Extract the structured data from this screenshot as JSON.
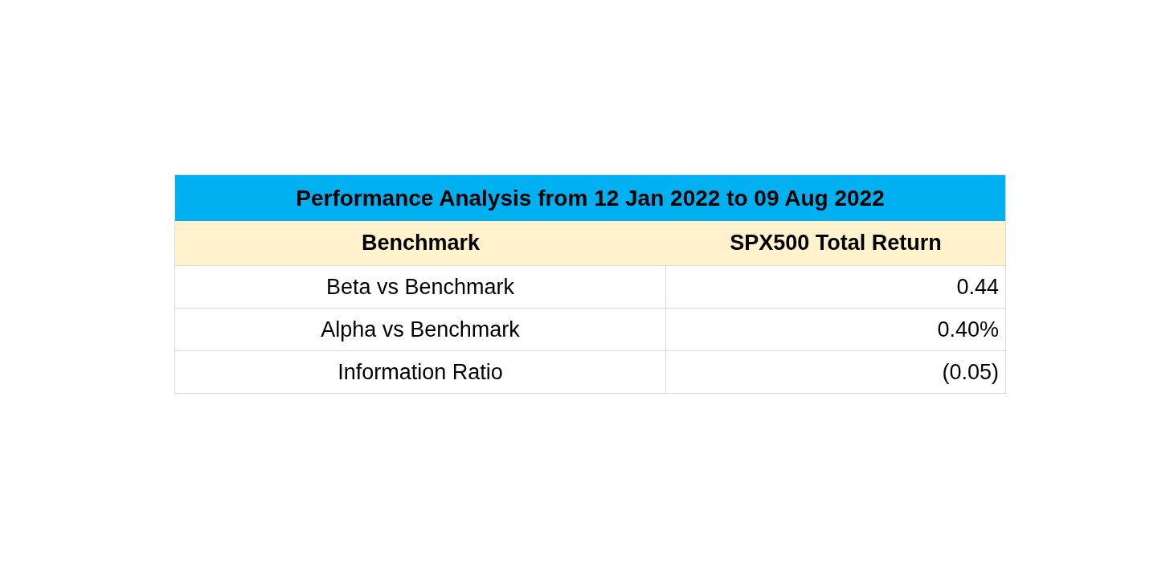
{
  "title": "Performance Analysis from 12 Jan 2022 to 09 Aug 2022",
  "header": [
    "Benchmark",
    "SPX500 Total Return"
  ],
  "rows": [
    {
      "label": "Beta vs Benchmark",
      "value": "0.44"
    },
    {
      "label": "Alpha vs Benchmark",
      "value": "0.40%"
    },
    {
      "label": "Information Ratio",
      "value": "(0.05)"
    }
  ]
}
